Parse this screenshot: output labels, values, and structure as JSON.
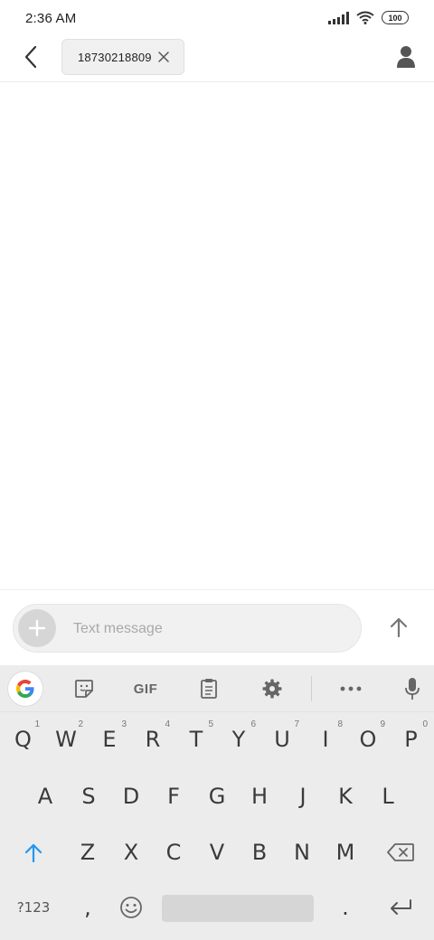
{
  "status_bar": {
    "time": "2:36 AM",
    "battery": "100",
    "icons": [
      "signal-icon",
      "wifi-icon",
      "battery-icon"
    ]
  },
  "header": {
    "back_icon": "chevron-left-icon",
    "recipient": "18730218809",
    "chip_close_icon": "close-icon",
    "contact_icon": "person-icon"
  },
  "compose": {
    "add_icon": "plus-icon",
    "placeholder": "Text message",
    "value": "",
    "send_icon": "arrow-up-icon"
  },
  "keyboard": {
    "toolbar": {
      "google": "google-icon",
      "sticker": "sticker-icon",
      "gif": "GIF",
      "clipboard": "clipboard-icon",
      "settings": "gear-icon",
      "more": "more-icon",
      "mic": "mic-icon"
    },
    "row1": [
      {
        "label": "Q",
        "hint": "1"
      },
      {
        "label": "W",
        "hint": "2"
      },
      {
        "label": "E",
        "hint": "3"
      },
      {
        "label": "R",
        "hint": "4"
      },
      {
        "label": "T",
        "hint": "5"
      },
      {
        "label": "Y",
        "hint": "6"
      },
      {
        "label": "U",
        "hint": "7"
      },
      {
        "label": "I",
        "hint": "8"
      },
      {
        "label": "O",
        "hint": "9"
      },
      {
        "label": "P",
        "hint": "0"
      }
    ],
    "row2": [
      "A",
      "S",
      "D",
      "F",
      "G",
      "H",
      "J",
      "K",
      "L"
    ],
    "row3": [
      "Z",
      "X",
      "C",
      "V",
      "B",
      "N",
      "M"
    ],
    "shift_icon": "shift-icon",
    "backspace_icon": "backspace-icon",
    "symbols_label": "?123",
    "comma": ",",
    "period": ".",
    "emoji_icon": "emoji-icon",
    "enter_icon": "enter-icon",
    "colors": {
      "shift_accent": "#2196f3",
      "keyboard_bg": "#ececec"
    }
  }
}
